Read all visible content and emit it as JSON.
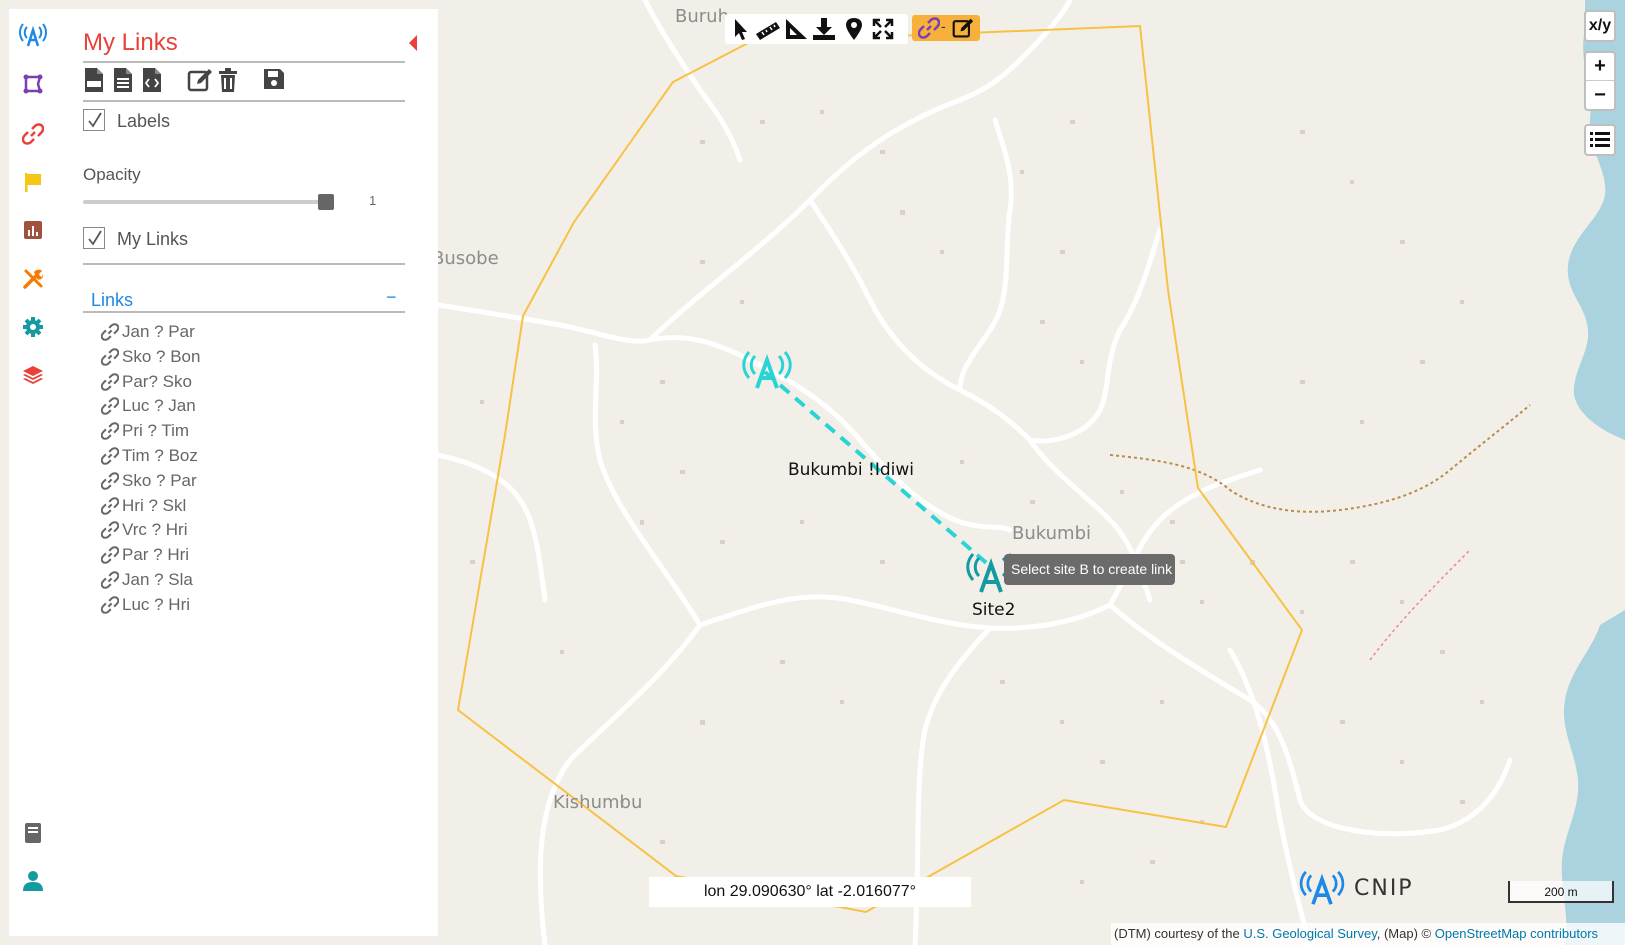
{
  "panel": {
    "title": "My Links",
    "labels_checkbox": "Labels",
    "opacity_label": "Opacity",
    "opacity_value": "1",
    "opacity_level": 1,
    "layer_checkbox": "My Links",
    "links_header": "Links",
    "links_collapse": "−",
    "links": [
      "Jan ? Par",
      "Sko ? Bon",
      "Par? Sko",
      "Luc ? Jan",
      "Pri ? Tim",
      "Tim ? Boz",
      "Sko ? Par",
      "Hri ? Skl",
      "Vrc ? Hri",
      "Par ? Hri",
      "Jan ? Sla",
      "Luc ? Hri"
    ],
    "toolbar_icons": [
      "csv-file-icon",
      "file-text-icon",
      "code-file-icon",
      "edit-icon",
      "trash-icon",
      "save-icon"
    ]
  },
  "sidebar_icons": [
    "antenna-icon",
    "polygon-icon",
    "link-icon",
    "flag-icon",
    "chart-icon",
    "tools-icon",
    "gear-icon",
    "layers-icon",
    "book-icon",
    "user-icon"
  ],
  "map": {
    "place_labels": [
      "Buruh",
      "Busobe",
      "Bukumbi",
      "Kishumbu"
    ],
    "link_label": "Bukumbi !Idiwi",
    "site_b_label": "Site2",
    "tooltip": "Select site B to create link",
    "coords": "lon 29.090630° lat -2.016077°",
    "scale": "200 m",
    "logo_text": "CNIP",
    "xy_button": "x/y",
    "zoom_in": "+",
    "zoom_out": "−"
  },
  "attribution": {
    "prefix": "(DTM) courtesy of the ",
    "usgs": "U.S. Geological Survey",
    "middle": ", (Map) © ",
    "osm": "OpenStreetMap contributors"
  },
  "colors": {
    "accent_red": "#e8413a",
    "link_blue": "#1e88e5",
    "site_cyan": "#2ad4d4",
    "site_teal": "#159aa0",
    "boundary": "#f7c244",
    "water": "#aad3df",
    "tool_orange": "#f7b13a"
  }
}
